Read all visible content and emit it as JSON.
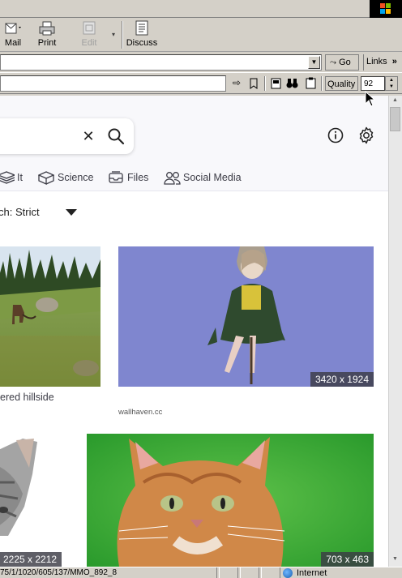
{
  "toolbar": {
    "mail_label": "Mail",
    "print_label": "Print",
    "edit_label": "Edit",
    "discuss_label": "Discuss"
  },
  "address_bar": {
    "value": "",
    "go_label": "Go",
    "links_label": "Links",
    "links_chevron": "»"
  },
  "plugin_bar": {
    "value": "",
    "quality_label": "Quality",
    "quality_value": "92"
  },
  "page": {
    "search_clear": "✕",
    "categories": [
      {
        "label": "It",
        "icon": "layers-icon"
      },
      {
        "label": "Science",
        "icon": "cube-icon"
      },
      {
        "label": "Files",
        "icon": "inbox-icon"
      },
      {
        "label": "Social Media",
        "icon": "people-icon"
      }
    ],
    "safe_search_label": "ch: Strict",
    "results": [
      {
        "caption": "ered hillside",
        "dimensions": "",
        "source": ""
      },
      {
        "caption": "",
        "dimensions": "3420 x 1924",
        "source": "wallhaven.cc"
      },
      {
        "caption": "",
        "dimensions": "2225 x 2212",
        "source": ""
      },
      {
        "caption": "",
        "dimensions": "703 x 463",
        "source": ""
      }
    ]
  },
  "status_bar": {
    "text": "75/1/1020/605/137/MMO_892_8",
    "zone": "Internet"
  },
  "colors": {
    "chrome": "#d4d0c8",
    "page_bg": "#ffffff",
    "header_bg": "#f8f8fb",
    "badge_bg": "#3c3c46",
    "purple_bg": "#7f86cf",
    "green_bg": "#3fae3a"
  }
}
